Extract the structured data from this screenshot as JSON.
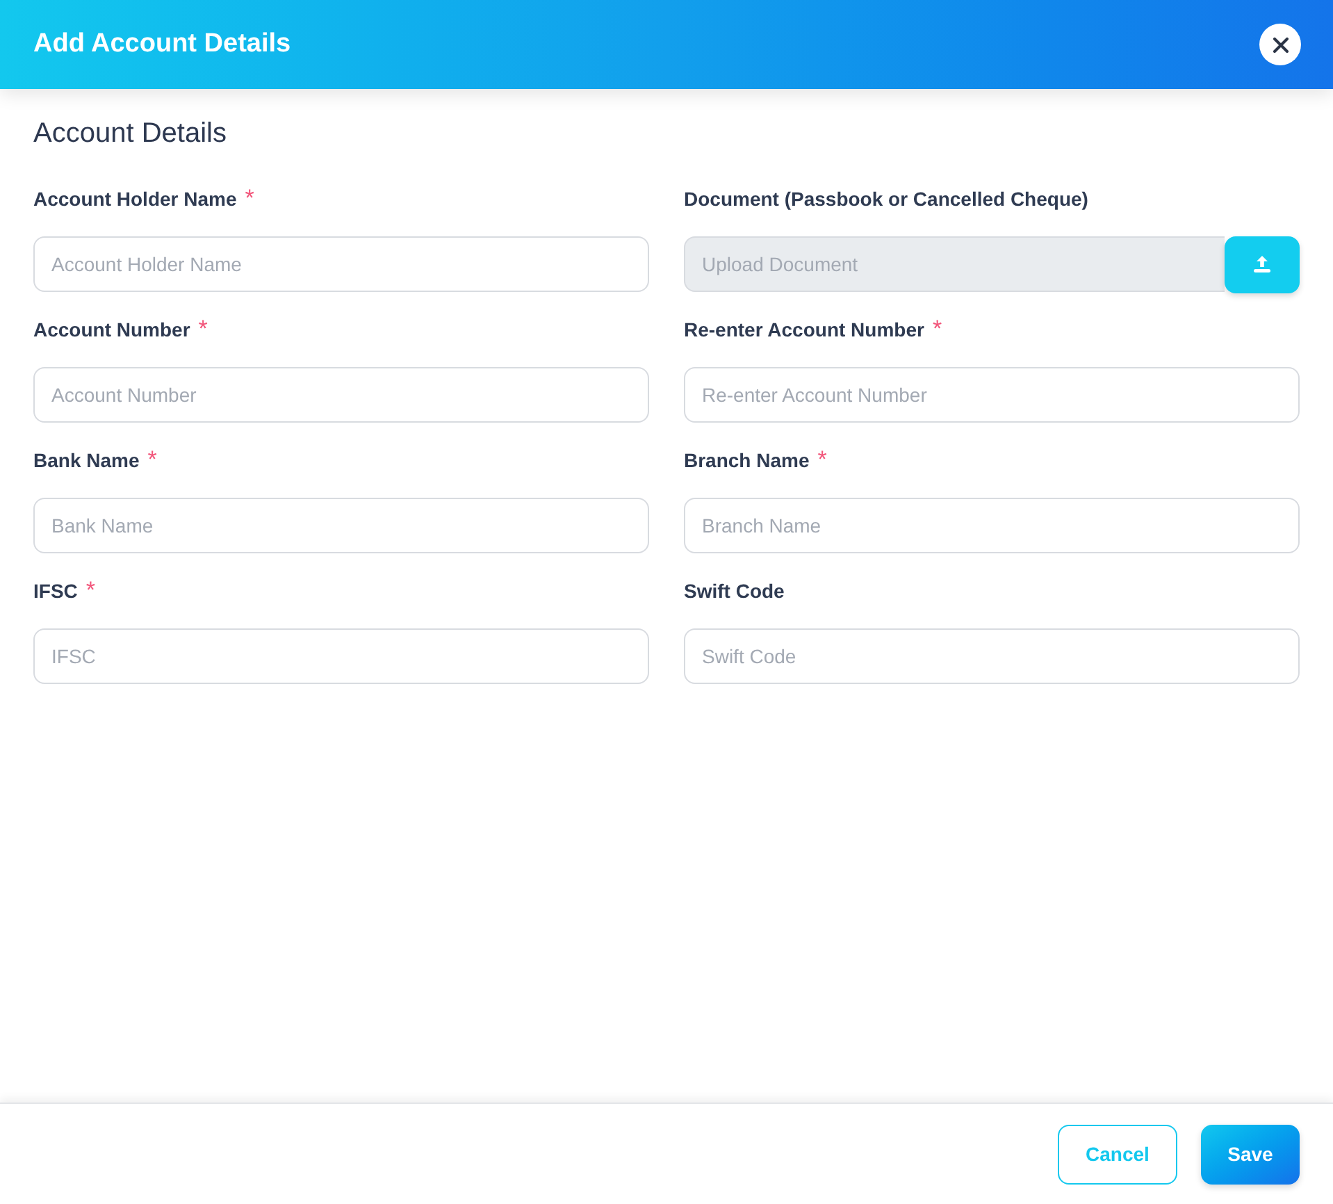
{
  "dialog": {
    "title": "Add Account Details"
  },
  "section": {
    "title": "Account Details"
  },
  "fields": [
    {
      "kind": "text",
      "label": "Account Holder Name",
      "required_mark": "*",
      "placeholder": "Account Holder Name"
    },
    {
      "kind": "upload",
      "label": "Document (Passbook or Cancelled Cheque)",
      "placeholder": "Upload Document"
    },
    {
      "kind": "text",
      "label": "Account Number",
      "required_mark": "*",
      "placeholder": "Account Number"
    },
    {
      "kind": "text",
      "label": "Re-enter Account Number",
      "required_mark": "*",
      "placeholder": "Re-enter Account Number"
    },
    {
      "kind": "text",
      "label": "Bank Name",
      "required_mark": "*",
      "placeholder": "Bank Name"
    },
    {
      "kind": "text",
      "label": "Branch Name",
      "required_mark": "*",
      "placeholder": "Branch Name"
    },
    {
      "kind": "text",
      "label": "IFSC",
      "required_mark": "*",
      "placeholder": "IFSC"
    },
    {
      "kind": "text",
      "label": "Swift Code",
      "placeholder": "Swift Code"
    }
  ],
  "buttons": [
    {
      "kind": "outline",
      "label": "Cancel"
    },
    {
      "kind": "primary",
      "label": "Save"
    }
  ]
}
